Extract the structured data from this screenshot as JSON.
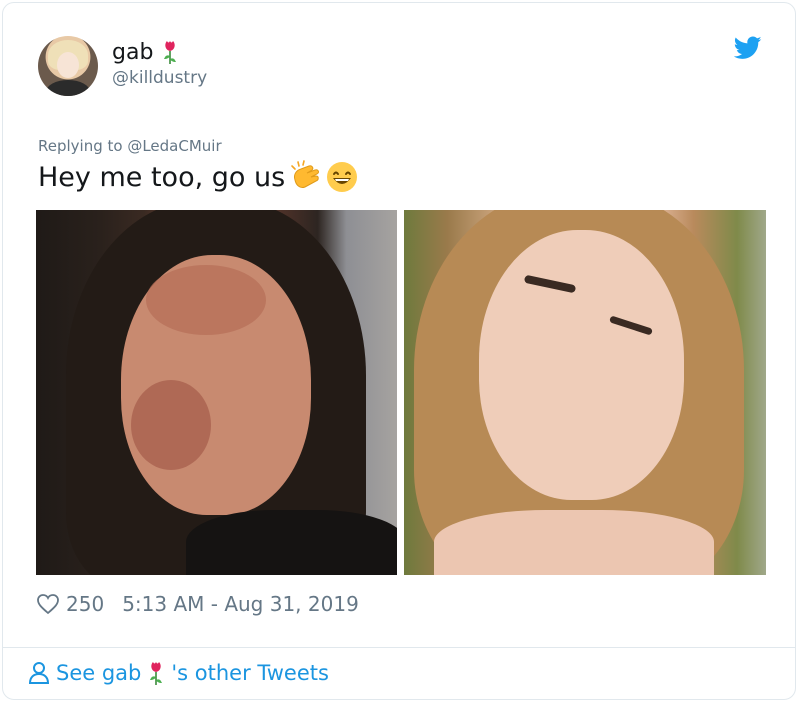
{
  "tweet": {
    "author_name": "gab",
    "author_handle": "@killdustry",
    "replying_to": "Replying to @LedaCMuir",
    "text": "Hey me too, go us",
    "likes": "250",
    "timestamp": "5:13 AM - Aug 31, 2019",
    "images": [
      "photo-before",
      "photo-after"
    ],
    "emojis": [
      "clapping-hands",
      "grinning-face-with-smiling-eyes"
    ]
  },
  "footer": {
    "see_prefix": "See gab",
    "see_suffix": "'s other Tweets"
  },
  "icons": {
    "bird": "twitter-bird-icon",
    "heart": "heart-icon",
    "user": "user-icon",
    "rose": "rose-emoji"
  },
  "colors": {
    "brand": "#1da1f2",
    "link": "#1b95e0",
    "muted": "#657786",
    "text": "#14171a",
    "border": "#e1e8ed"
  }
}
